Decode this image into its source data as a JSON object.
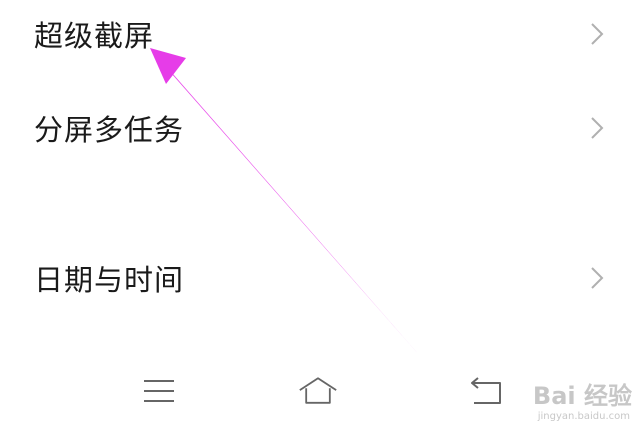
{
  "settings": {
    "items": [
      {
        "label": "超级截屏"
      },
      {
        "label": "分屏多任务"
      },
      {
        "label": "日期与时间"
      }
    ]
  },
  "navigation": {
    "buttons": [
      "menu-icon",
      "home-icon",
      "back-icon"
    ]
  },
  "annotation": {
    "arrow_color": "#e63ce8"
  },
  "watermark": {
    "brand": "Bai 经验",
    "url": "jingyan.baidu.com"
  },
  "colors": {
    "text": "#1a1a1a",
    "chevron": "#b0b0b0",
    "nav_icon": "#666666",
    "background": "#ffffff"
  }
}
